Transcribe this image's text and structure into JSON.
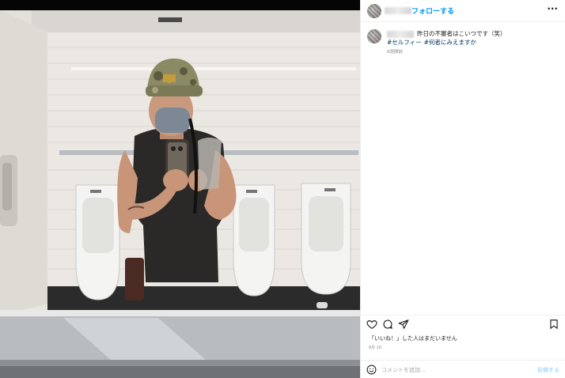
{
  "header": {
    "follow_label": "フォローする",
    "more_label": "···",
    "avatar_icon": "avatar",
    "username_obscured": true
  },
  "caption": {
    "text": "昨日の不審者はこいつです（笑）",
    "hashtags": [
      "#セルフィー",
      "#何者にみえますか"
    ],
    "time": "8週間前"
  },
  "actions": {
    "icons": [
      "heart-icon",
      "comment-icon",
      "share-icon",
      "bookmark-icon"
    ]
  },
  "likes_text": "「いいね！」した人はまだいません",
  "posted_date": "8月 10",
  "comment": {
    "placeholder": "コメントを追加...",
    "post_label": "投稿する",
    "emoji_icon": "smiley-icon"
  },
  "colors": {
    "accent": "#0095f6",
    "hashtag": "#00376b",
    "muted": "#8e8e8e",
    "border": "#efefef"
  }
}
